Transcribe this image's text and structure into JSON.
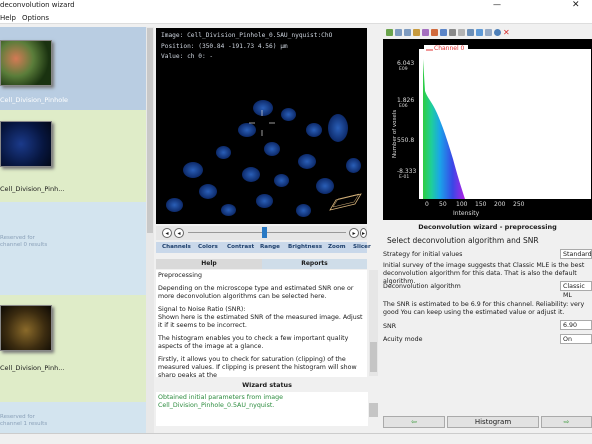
{
  "window": {
    "title": "deconvolution wizard",
    "minimize": "—",
    "close": "✕"
  },
  "menu": [
    {
      "label": "Help"
    },
    {
      "label": "Options"
    }
  ],
  "thumbnails": [
    {
      "label": "Cell_Division_Pinhole"
    },
    {
      "label": "Cell_Division_Pinh..."
    },
    {
      "line1": "Reserved for",
      "line2": "channel 0 results"
    },
    {
      "label": "Cell_Division_Pinh..."
    },
    {
      "line1": "Reserved for",
      "line2": "channel 1 results"
    }
  ],
  "viewer": {
    "image": "Image: Cell_Division_Pinhole_0.5AU_nyquist:ChO",
    "position": "Position: (350.84 -191.73 4.56) µm",
    "value": "Value: ch 0: -"
  },
  "view_tabs": [
    "Channels",
    "Colors",
    "Contrast",
    "Range",
    "Brightness",
    "Zoom",
    "Slicer"
  ],
  "help_tabs": {
    "help": "Help",
    "reports": "Reports"
  },
  "help": {
    "heading": "Preprocessing",
    "p1": "Depending on the microscope type and estimated SNR one or more deconvolution algorithms can be selected here.",
    "p2a": "Signal to Noise Ratio (SNR):",
    "p2b": "Shown here is the estimated SNR of the measured image. Adjust it if it seems to be incorrect.",
    "p3": "The histogram enables you to check a few important quality aspects of the image at a glance.",
    "p4": "Firstly, it allows you to check for saturation (clipping) of the measured values. If clipping is present the histogram will show sharp peaks at the"
  },
  "wizard_status": {
    "title": "Wizard status",
    "text": "Obtained initial parameters from image Cell_Division_Pinhole_0.5AU_nyquist."
  },
  "histogram": {
    "legend": "Channel 0",
    "ylabel": "Number of voxels",
    "xlabel": "Intensity",
    "yticks": [
      {
        "v": "6.043",
        "e": "E09"
      },
      {
        "v": "1.826",
        "e": "E06"
      },
      {
        "v": "550.8",
        "e": ""
      },
      {
        "v": "-8.333",
        "e": "E-01"
      }
    ],
    "xticks": [
      "0",
      "50",
      "100",
      "150",
      "200",
      "250"
    ]
  },
  "right_panel": {
    "title": "Deconvolution wizard - preprocessing",
    "subtitle": "Select deconvolution algorithm and SNR",
    "strategy_label": "Strategy for initial values",
    "strategy_value": "Standard",
    "survey_text": "Initial survey of the image suggests that Classic MLE is the best deconvolution algorithm for this data. That is also the default algorithm.",
    "algorithm_label": "Deconvolution algorithm",
    "algorithm_value": "Classic ML",
    "snr_text": "The SNR is estimated to be 6.9 for this channel. Reliability: very good You can keep using the estimated value or adjust it.",
    "snr_label": "SNR",
    "snr_value": "6.90",
    "acuity_label": "Acuity mode",
    "acuity_value": "On"
  },
  "buttons": {
    "prev": "⇦",
    "histogram": "Histogram",
    "next": "⇨"
  }
}
